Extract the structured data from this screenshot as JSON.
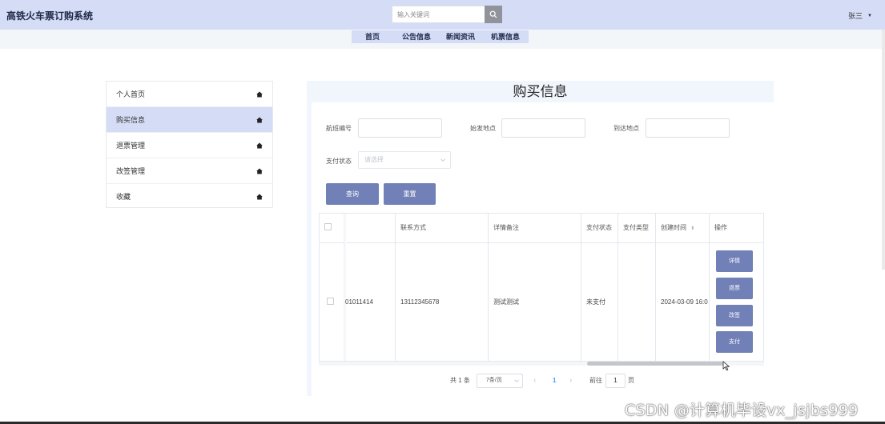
{
  "header": {
    "brand": "高铁火车票订购系统",
    "search_placeholder": "输入关键词",
    "user_name": "张三"
  },
  "nav": {
    "items": [
      "首页",
      "公告信息",
      "新闻资讯",
      "机票信息"
    ]
  },
  "sidebar": {
    "items": [
      {
        "label": "个人首页",
        "active": false
      },
      {
        "label": "购买信息",
        "active": true
      },
      {
        "label": "退票管理",
        "active": false
      },
      {
        "label": "改签管理",
        "active": false
      },
      {
        "label": "收藏",
        "active": false
      }
    ]
  },
  "main": {
    "title": "购买信息",
    "filters": {
      "flight_no_label": "航班编号",
      "departure_label": "始发地点",
      "arrival_label": "到达地点",
      "pay_status_label": "支付状态",
      "pay_status_placeholder": "请选择"
    },
    "buttons": {
      "query": "查询",
      "reset": "重置"
    },
    "table": {
      "headers": [
        "",
        "联系方式",
        "详情备注",
        "支付状态",
        "支付类型",
        "创建时间",
        "操作"
      ],
      "rows": [
        {
          "partial_id": "01011414",
          "contact": "13112345678",
          "remark": "测试测试",
          "pay_status": "未支付",
          "pay_type": "",
          "created": "2024-03-09 16:0",
          "actions": [
            "详情",
            "退票",
            "改签",
            "支付"
          ]
        }
      ]
    },
    "pagination": {
      "total": "共 1 条",
      "page_size": "7条/页",
      "prev": "‹",
      "current": "1",
      "next": "›",
      "goto_label": "前往",
      "goto_value": "1",
      "page_suffix": "页"
    }
  },
  "watermark": "CSDN @计算机毕设vx_jsjbs999",
  "colors": {
    "header_bg": "#d5dcf5",
    "accent": "#7280b8",
    "panel_bg": "#f1f6fd"
  }
}
